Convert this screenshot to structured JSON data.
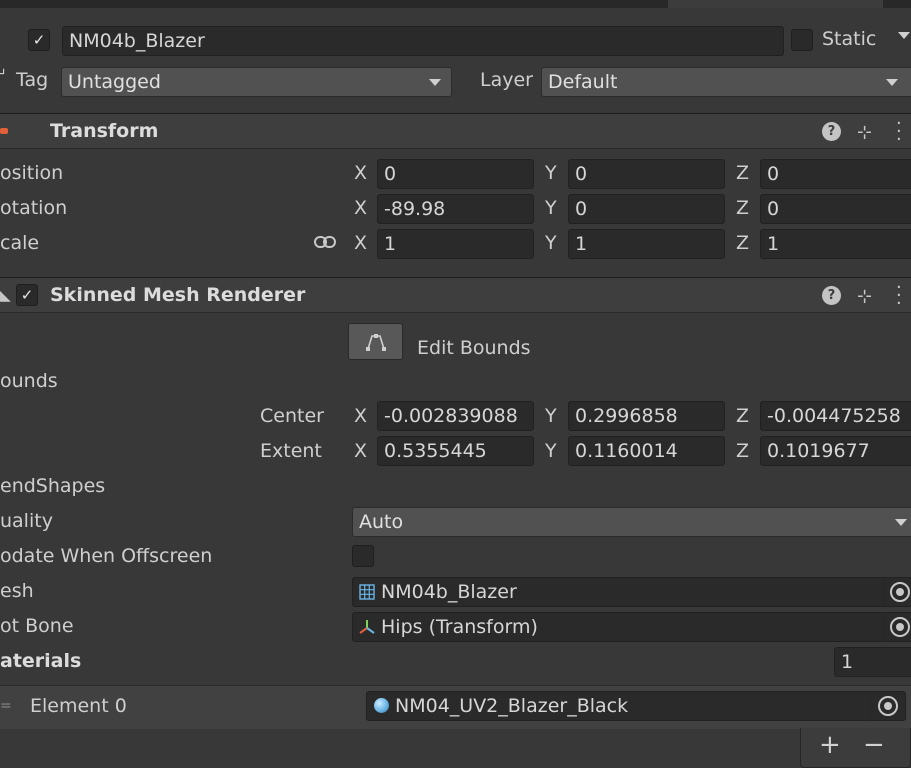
{
  "header": {
    "object_name": "NM04b_Blazer",
    "static_label": "Static",
    "tag_label": "Tag",
    "tag_value": "Untagged",
    "layer_label": "Layer",
    "layer_value": "Default"
  },
  "transform": {
    "title": "Transform",
    "position_label": "osition",
    "rotation_label": "otation",
    "scale_label": "cale",
    "axis_x": "X",
    "axis_y": "Y",
    "axis_z": "Z",
    "position": {
      "x": "0",
      "y": "0",
      "z": "0"
    },
    "rotation": {
      "x": "-89.98",
      "y": "0",
      "z": "0"
    },
    "scale": {
      "x": "1",
      "y": "1",
      "z": "1"
    }
  },
  "renderer": {
    "title": "Skinned Mesh Renderer",
    "edit_bounds_label": "Edit Bounds",
    "bounds_label": "ounds",
    "center_label": "Center",
    "extent_label": "Extent",
    "center": {
      "x": "-0.002839088",
      "y": "0.2996858",
      "z": "-0.004475258"
    },
    "extent": {
      "x": "0.5355445",
      "y": "0.1160014",
      "z": "0.1019677"
    },
    "blendshapes_label": "endShapes",
    "quality_label": "uality",
    "quality_value": "Auto",
    "update_offscreen_label": "odate When Offscreen",
    "mesh_label": "esh",
    "mesh_value": "NM04b_Blazer",
    "root_bone_label": "ot Bone",
    "root_bone_value": "Hips (Transform)",
    "materials_label": "aterials",
    "materials_count": "1",
    "element0_label": "Element 0",
    "element0_value": "NM04_UV2_Blazer_Black"
  },
  "footer": {
    "add": "+",
    "remove": "−"
  },
  "colors": {
    "background": "#383838",
    "field": "#2a2a2a",
    "section_header": "#3e3e3e",
    "transform_icon": "#e0603a",
    "material_icon": "#6bb6e6"
  }
}
